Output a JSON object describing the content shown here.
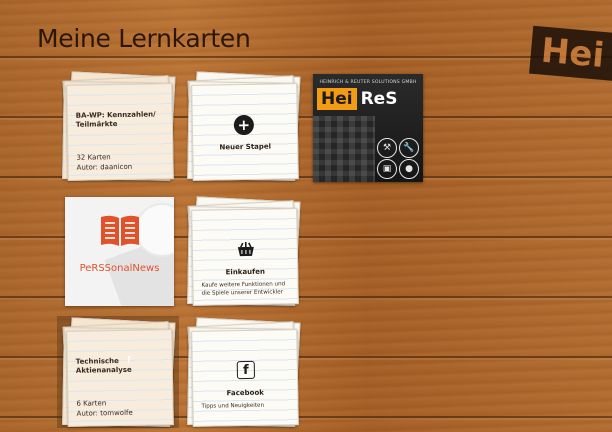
{
  "app": {
    "title": "Meine Lernkarten",
    "corner_logo": "Hei"
  },
  "decks": [
    {
      "title": "BA-WP: Kennzahlen/ Teilmärkte",
      "count": "32 Karten",
      "author": "Autor: daanicon"
    },
    {
      "title": "Technische Aktienanalyse",
      "count": "6 Karten",
      "author": "Autor: tomwolfe"
    }
  ],
  "actions": {
    "new_deck": {
      "label": "Neuer Stapel",
      "icon": "plus-circle-icon"
    },
    "shop": {
      "label": "Einkaufen",
      "description": "Kaufe weitere Funktionen und die Spiele unserer Entwickler",
      "icon": "basket-icon"
    },
    "facebook": {
      "label": "Facebook",
      "description": "Tipps und Neuigkeiten",
      "icon": "facebook-icon"
    }
  },
  "promos": {
    "heires": {
      "subtitle": "HEINRICH & REUTER SOLUTIONS GMBH",
      "logo_hei": "Hei",
      "logo_res": "ReS"
    },
    "news": {
      "name": "PeRSSonalNews"
    }
  },
  "colors": {
    "accent_orange": "#f39b12",
    "news_orange": "#e0522a",
    "wood": "#b06c30"
  }
}
